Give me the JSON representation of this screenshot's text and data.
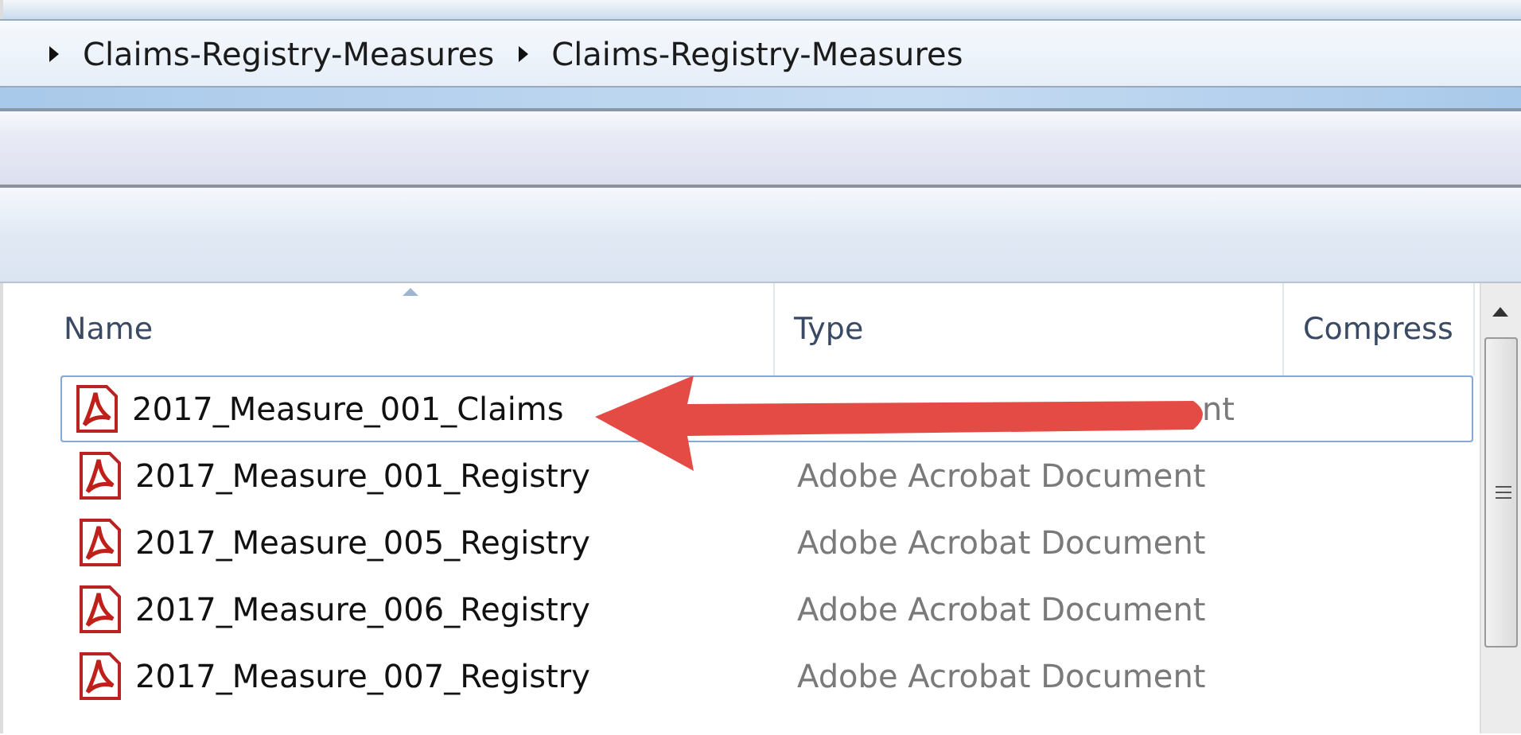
{
  "breadcrumb": [
    {
      "label": "Claims-Registry-Measures"
    },
    {
      "label": "Claims-Registry-Measures"
    }
  ],
  "columns": [
    {
      "label": "Name",
      "sorted": true
    },
    {
      "label": "Type",
      "sorted": false
    },
    {
      "label": "Compress",
      "sorted": false
    }
  ],
  "files": [
    {
      "name": "2017_Measure_001_Claims",
      "type": "nt",
      "selected": true
    },
    {
      "name": "2017_Measure_001_Registry",
      "type": "Adobe Acrobat Document",
      "selected": false
    },
    {
      "name": "2017_Measure_005_Registry",
      "type": "Adobe Acrobat Document",
      "selected": false
    },
    {
      "name": "2017_Measure_006_Registry",
      "type": "Adobe Acrobat Document",
      "selected": false
    },
    {
      "name": "2017_Measure_007_Registry",
      "type": "Adobe Acrobat Document",
      "selected": false
    }
  ]
}
